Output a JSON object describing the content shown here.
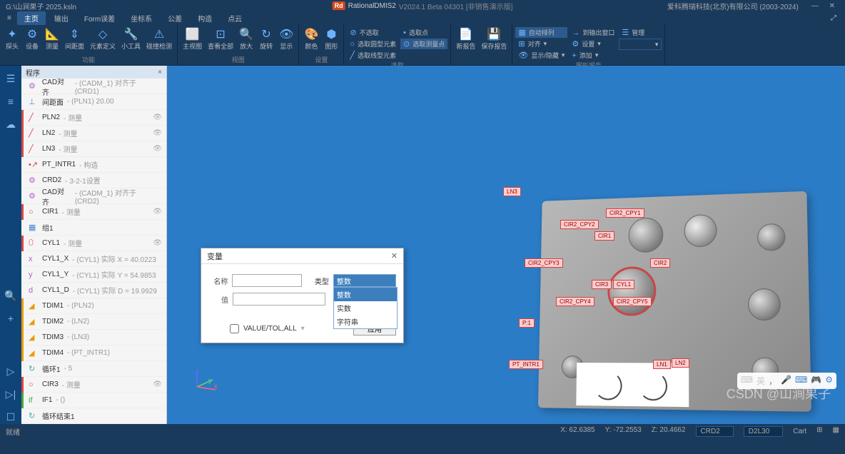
{
  "titlebar": {
    "file": "G:\\山涧果子 2025.ksln",
    "app": "RationalDMIS2",
    "version": "V2024.1 Beta 04301 [非销售演示版]",
    "company": "爱科腾瑞科技(北京)有限公司 (2003-2024)"
  },
  "menu": {
    "items": [
      "主页",
      "输出",
      "Form误差",
      "坐标系",
      "公差",
      "构造",
      "点云"
    ],
    "active": 0
  },
  "ribbon": {
    "g1": {
      "label": "功能",
      "btns": [
        "探头",
        "设备",
        "测量",
        "间距面",
        "元素定义",
        "小工具",
        "碰撞检测"
      ]
    },
    "g2": {
      "label": "视图",
      "btns": [
        "主视图",
        "查看全部",
        "放大",
        "旋转",
        "显示"
      ]
    },
    "g3": {
      "label": "设置",
      "btns": [
        "颜色",
        "图形"
      ]
    },
    "g4": {
      "label": "选取",
      "opts": [
        "不选取",
        "选取点",
        "选取圆型元素",
        "选取测量点",
        "选取线型元素"
      ]
    },
    "g5": {
      "label": "",
      "btns": [
        "新报告",
        "保存报告"
      ]
    },
    "g6": {
      "label": "图形报告",
      "a": "自动排列",
      "b": "对齐",
      "c": "显示/隐藏",
      "d": "到输出窗口",
      "e": "管理",
      "f": "设置",
      "g": "添加"
    }
  },
  "leftbar": [
    "☰",
    "≡",
    "⊕",
    "",
    "🔍",
    "+",
    "",
    "▷",
    "▷|",
    "☐"
  ],
  "sidebar": {
    "title": "程序",
    "items": [
      {
        "marker": "",
        "icon": "⚙",
        "iconc": "icon-purple",
        "name": "CAD对齐",
        "detail": " - (CADM_1) 对齐于 (CRD1)",
        "eye": ""
      },
      {
        "marker": "",
        "icon": "⊥",
        "iconc": "icon-blue",
        "name": "间距面",
        "detail": " - (PLN1) 20.00",
        "eye": ""
      },
      {
        "marker": "red",
        "icon": "╱",
        "iconc": "icon-red",
        "name": "PLN2",
        "detail": " - 测量",
        "eye": "👁"
      },
      {
        "marker": "red",
        "icon": "╱",
        "iconc": "icon-red",
        "name": "LN2",
        "detail": " - 测量",
        "eye": "👁"
      },
      {
        "marker": "red",
        "icon": "╱",
        "iconc": "icon-red",
        "name": "LN3",
        "detail": " - 测量",
        "eye": "👁"
      },
      {
        "marker": "",
        "icon": "•↗",
        "iconc": "icon-red",
        "name": "PT_INTR1",
        "detail": " - 构造",
        "eye": ""
      },
      {
        "marker": "",
        "icon": "⚙",
        "iconc": "icon-purple",
        "name": "CRD2",
        "detail": " - 3-2-1设置",
        "eye": ""
      },
      {
        "marker": "",
        "icon": "⚙",
        "iconc": "icon-purple",
        "name": "CAD对齐",
        "detail": " - (CADM_1) 对齐于 (CRD2)",
        "eye": ""
      },
      {
        "marker": "red",
        "icon": "○",
        "iconc": "icon-red",
        "name": "CIR1",
        "detail": " - 测量",
        "eye": "👁"
      },
      {
        "marker": "",
        "icon": "▦",
        "iconc": "icon-blue",
        "name": "组1",
        "detail": "",
        "eye": ""
      },
      {
        "marker": "red",
        "icon": "⬯",
        "iconc": "icon-red",
        "name": "CYL1",
        "detail": " - 测量",
        "eye": "👁"
      },
      {
        "marker": "",
        "icon": "x",
        "iconc": "icon-purple",
        "name": "CYL1_X",
        "detail": " - (CYL1) 实际 X = 40.0223",
        "eye": ""
      },
      {
        "marker": "",
        "icon": "y",
        "iconc": "icon-purple",
        "name": "CYL1_Y",
        "detail": " - (CYL1) 实际 Y = 54.9853",
        "eye": ""
      },
      {
        "marker": "",
        "icon": "d",
        "iconc": "icon-purple",
        "name": "CYL1_D",
        "detail": " - (CYL1) 实际 D = 19.9929",
        "eye": ""
      },
      {
        "marker": "orange",
        "icon": "◢",
        "iconc": "icon-orange",
        "name": "TDIM1",
        "detail": " - (PLN2)",
        "eye": ""
      },
      {
        "marker": "orange",
        "icon": "◢",
        "iconc": "icon-orange",
        "name": "TDIM2",
        "detail": " - (LN2)",
        "eye": ""
      },
      {
        "marker": "orange",
        "icon": "◢",
        "iconc": "icon-orange",
        "name": "TDIM3",
        "detail": " - (LN3)",
        "eye": ""
      },
      {
        "marker": "orange",
        "icon": "◢",
        "iconc": "icon-orange",
        "name": "TDIM4",
        "detail": " - (PT_INTR1)",
        "eye": ""
      },
      {
        "marker": "",
        "icon": "↻",
        "iconc": "icon-teal",
        "name": "循环1",
        "detail": " - 5",
        "eye": ""
      },
      {
        "marker": "red",
        "icon": "○",
        "iconc": "icon-red",
        "name": "CIR3",
        "detail": " - 测量",
        "eye": "👁"
      },
      {
        "marker": "green",
        "icon": "if",
        "iconc": "icon-green",
        "name": "IF1",
        "detail": " - ()",
        "eye": ""
      },
      {
        "marker": "",
        "icon": "↻",
        "iconc": "icon-teal",
        "name": "循环结束1",
        "detail": "",
        "eye": ""
      }
    ]
  },
  "tags": {
    "ln3": "LN3",
    "cir2cpy1": "CIR2_CPY1",
    "cir2cpy2": "CIR2_CPY2",
    "cir1": "CIR1",
    "cir2cpy3": "CIR2_CPY3",
    "cir2": "CIR2",
    "cir3": "CIR3",
    "cyl1": "CYL1",
    "cir2cpy4": "CIR2_CPY4",
    "cir2cpy5": "CIR2_CPY5",
    "p1": "P:1",
    "ptintr1": "PT_INTR1",
    "ln1": "LN1",
    "ln2": "LN2"
  },
  "dialog": {
    "title": "变量",
    "name_label": "名称",
    "type_label": "类型",
    "value_label": "值",
    "checkbox": "VALUE/TOL,ALL",
    "apply": "应用",
    "type_selected": "整数",
    "type_options": [
      "整数",
      "实数",
      "字符串"
    ]
  },
  "floatbar": {
    "a": "英"
  },
  "watermark": "CSDN @山涧果子",
  "status": {
    "left": "就绪",
    "x": "X: 62.6385",
    "y": "Y: -72.2553",
    "z": "Z: 20.4662",
    "crd": "CRD2",
    "d": "D2L30",
    "cart": "Cart"
  },
  "axis": {
    "x": "x",
    "y": "y",
    "z": "z"
  }
}
